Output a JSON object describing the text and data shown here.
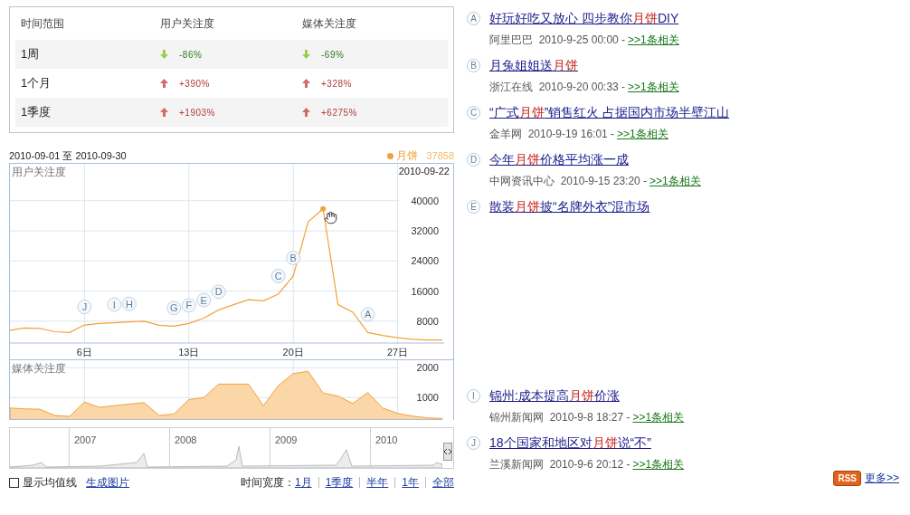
{
  "summary_table": {
    "columns": [
      "时间范围",
      "用户关注度",
      "媒体关注度"
    ],
    "rows": [
      {
        "range": "1周",
        "user": {
          "kind": "down",
          "value": "-86%"
        },
        "media": {
          "kind": "down",
          "value": "-69%"
        }
      },
      {
        "range": "1个月",
        "user": {
          "kind": "up",
          "value": "+390%"
        },
        "media": {
          "kind": "up",
          "value": "+328%"
        }
      },
      {
        "range": "1季度",
        "user": {
          "kind": "up",
          "value": "+1903%"
        },
        "media": {
          "kind": "up",
          "value": "+6275%"
        }
      }
    ]
  },
  "period": "2010-09-01 至 2010-09-30",
  "legend": {
    "value": "37858"
  },
  "user_chart": {
    "label": "用户关注度",
    "hover_date": "2010-09-22",
    "chart_data": {
      "type": "line",
      "grid": true,
      "x": [
        1,
        2,
        3,
        4,
        5,
        6,
        7,
        8,
        9,
        10,
        11,
        12,
        13,
        14,
        15,
        16,
        17,
        18,
        19,
        20,
        21,
        22,
        23,
        24,
        25,
        26,
        27,
        28,
        29,
        30
      ],
      "xticks": [
        {
          "value": 6,
          "label": "6日"
        },
        {
          "value": 13,
          "label": "13日"
        },
        {
          "value": 20,
          "label": "20日"
        },
        {
          "value": 27,
          "label": "27日"
        }
      ],
      "yticks": [
        8000,
        16000,
        24000,
        32000,
        40000
      ],
      "xlim": [
        1,
        30
      ],
      "ylim": [
        2200,
        49800
      ],
      "series": [
        {
          "name": "月饼",
          "color": "#f0a23c",
          "values": [
            5600,
            6200,
            6100,
            5200,
            5000,
            7000,
            7400,
            7600,
            7800,
            8000,
            6900,
            6700,
            7400,
            8800,
            11000,
            12400,
            13700,
            13400,
            15200,
            20000,
            34400,
            37858,
            12400,
            10400,
            5000,
            4200,
            3600,
            3200,
            3000,
            3000
          ]
        }
      ],
      "annotations": [
        {
          "x": 6,
          "text": "J"
        },
        {
          "x": 8,
          "text": "I"
        },
        {
          "x": 9,
          "text": "H"
        },
        {
          "x": 12,
          "text": "G"
        },
        {
          "x": 13,
          "text": "F"
        },
        {
          "x": 14,
          "text": "E"
        },
        {
          "x": 15,
          "text": "D"
        },
        {
          "x": 19,
          "text": "C"
        },
        {
          "x": 20,
          "text": "B"
        },
        {
          "x": 25,
          "text": "A"
        }
      ]
    }
  },
  "media_chart": {
    "label": "媒体关注度",
    "chart_data": {
      "type": "area",
      "grid": true,
      "x": [
        1,
        2,
        3,
        4,
        5,
        6,
        7,
        8,
        9,
        10,
        11,
        12,
        13,
        14,
        15,
        16,
        17,
        18,
        19,
        20,
        21,
        22,
        23,
        24,
        25,
        26,
        27,
        28,
        29,
        30
      ],
      "yticks": [
        1000,
        2000
      ],
      "xlim": [
        1,
        30
      ],
      "ylim": [
        250,
        2250
      ],
      "series": [
        {
          "color": "#f0a23c",
          "values": [
            650,
            620,
            610,
            400,
            370,
            850,
            670,
            730,
            780,
            830,
            400,
            450,
            930,
            1000,
            1450,
            1450,
            1450,
            730,
            1400,
            1800,
            1880,
            1150,
            1050,
            800,
            1170,
            650,
            470,
            380,
            320,
            300
          ]
        }
      ]
    }
  },
  "overview": {
    "years": [
      "2007",
      "2008",
      "2009",
      "2010"
    ]
  },
  "controls": {
    "show_average": {
      "label": "显示均值线",
      "checked": false
    },
    "export": "生成图片",
    "width_label": "时间宽度：",
    "widths": [
      "1月",
      "1季度",
      "半年",
      "1年",
      "全部"
    ]
  },
  "news": [
    {
      "marker": "A",
      "title": [
        {
          "text": "好玩好吃又放心 四步教你",
          "hl": false
        },
        {
          "text": "月饼",
          "hl": true
        },
        {
          "text": "DIY",
          "hl": false
        }
      ],
      "source": "阿里巴巴  2010-9-25 00:00 -",
      "related": ">>1条相关"
    },
    {
      "marker": "B",
      "title": [
        {
          "text": "月兔姐姐送",
          "hl": false
        },
        {
          "text": "月饼",
          "hl": true
        }
      ],
      "source": "浙江在线  2010-9-20 00:33 -",
      "related": ">>1条相关"
    },
    {
      "marker": "C",
      "title": [
        {
          "text": "“广式",
          "hl": false
        },
        {
          "text": "月饼",
          "hl": true
        },
        {
          "text": "”销售红火 占据国内市场半壁江山",
          "hl": false
        }
      ],
      "source": "金羊网  2010-9-19 16:01 -",
      "related": ">>1条相关"
    },
    {
      "marker": "D",
      "title": [
        {
          "text": "今年",
          "hl": false
        },
        {
          "text": "月饼",
          "hl": true
        },
        {
          "text": "价格平均涨一成",
          "hl": false
        }
      ],
      "source": "中网资讯中心  2010-9-15 23:20 -",
      "related": ">>1条相关"
    },
    {
      "marker": "E",
      "title": [
        {
          "text": "散装",
          "hl": false
        },
        {
          "text": "月饼",
          "hl": true
        },
        {
          "text": "披“名牌外衣”混市场",
          "hl": false
        }
      ]
    },
    {
      "marker": "I",
      "title": [
        {
          "text": "锦州:成本提高",
          "hl": false
        },
        {
          "text": "月饼",
          "hl": true
        },
        {
          "text": "价涨",
          "hl": false
        }
      ],
      "source": "锦州新闻网  2010-9-8 18:27 -",
      "related": ">>1条相关"
    },
    {
      "marker": "J",
      "title": [
        {
          "text": "18个国家和地区对",
          "hl": false
        },
        {
          "text": "月饼",
          "hl": true
        },
        {
          "text": "说“不”",
          "hl": false
        }
      ],
      "source": "兰溪新闻网  2010-9-6 20:12 -",
      "related": ">>1条相关"
    }
  ],
  "rss": "RSS",
  "more": "更多>>"
}
